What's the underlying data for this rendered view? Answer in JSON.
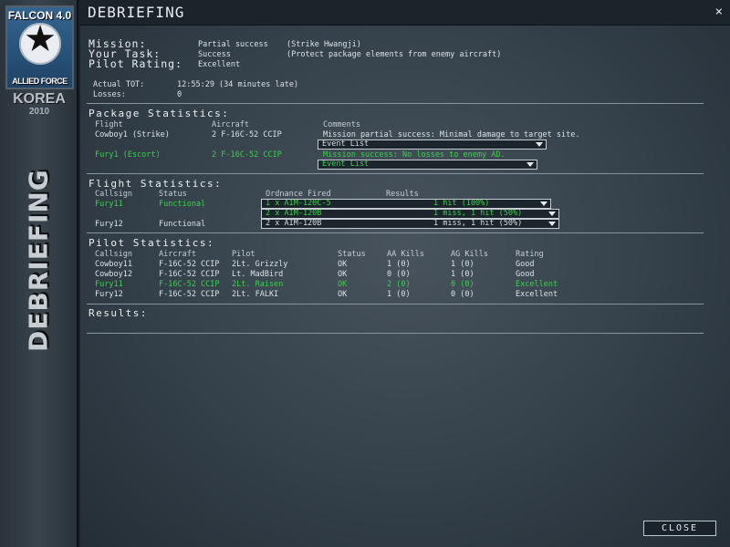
{
  "logo": {
    "top": "FALCON 4.0",
    "bottom": "ALLIED FORCE",
    "theater": "KOREA",
    "year": "2010"
  },
  "sidebar_title": "DEBRIEFING",
  "title": "DEBRIEFING",
  "close_x": "×",
  "summary": {
    "mission_label": "Mission:",
    "mission_value": "Partial success",
    "mission_note": "(Strike Hwangji)",
    "task_label": "Your Task:",
    "task_value": "Success",
    "task_note": "(Protect package elements from enemy aircraft)",
    "rating_label": "Pilot Rating:",
    "rating_value": "Excellent",
    "tot_label": "Actual TOT:",
    "tot_value": "12:55:29 (34 minutes late)",
    "losses_label": "Losses:",
    "losses_value": "0"
  },
  "package": {
    "title": "Package Statistics:",
    "headers": {
      "flight": "Flight",
      "aircraft": "Aircraft",
      "comments": "Comments"
    },
    "rows": [
      {
        "flight": "Cowboy1 (Strike)",
        "aircraft": "2 F-16C-52 CCIP",
        "comment": "Mission partial success: Minimal damage to target site.",
        "dropdown": "Event List",
        "highlight": false
      },
      {
        "flight": "Fury1 (Escort)",
        "aircraft": "2 F-16C-52 CCIP",
        "comment": "Mission success: No losses to enemy AD.",
        "dropdown": "Event List",
        "highlight": true
      }
    ]
  },
  "flight": {
    "title": "Flight Statistics:",
    "headers": {
      "callsign": "Callsign",
      "status": "Status",
      "ordnance": "Ordnance Fired",
      "results": "Results"
    },
    "rows": [
      {
        "callsign": "Fury11",
        "status": "Functional",
        "ordnance": [
          {
            "weapon": "1 x AIM-120C-5",
            "result": "1 hit (100%)"
          },
          {
            "weapon": "2 x AIM-120B",
            "result": "1 miss, 1 hit (50%)"
          }
        ]
      },
      {
        "callsign": "Fury12",
        "status": "Functional",
        "ordnance": [
          {
            "weapon": "2 x AIM-120B",
            "result": "1 miss, 1 hit (50%)"
          }
        ]
      }
    ]
  },
  "pilot": {
    "title": "Pilot Statistics:",
    "headers": {
      "callsign": "Callsign",
      "aircraft": "Aircraft",
      "pilot": "Pilot",
      "status": "Status",
      "aa": "AA Kills",
      "ag": "AG Kills",
      "rating": "Rating"
    },
    "rows": [
      {
        "callsign": "Cowboy11",
        "aircraft": "F-16C-52 CCIP",
        "pilot": "2Lt. Grizzly",
        "status": "OK",
        "aa": "1 (0)",
        "ag": "1 (0)",
        "rating": "Good",
        "highlight": false
      },
      {
        "callsign": "Cowboy12",
        "aircraft": "F-16C-52 CCIP",
        "pilot": "Lt. MadBird",
        "status": "OK",
        "aa": "0 (0)",
        "ag": "1 (0)",
        "rating": "Good",
        "highlight": false
      },
      {
        "callsign": "Fury11",
        "aircraft": "F-16C-52 CCIP",
        "pilot": "2Lt. Raisen",
        "status": "OK",
        "aa": "2 (0)",
        "ag": "0 (0)",
        "rating": "Excellent",
        "highlight": true
      },
      {
        "callsign": "Fury12",
        "aircraft": "F-16C-52 CCIP",
        "pilot": "2Lt. FALKI",
        "status": "OK",
        "aa": "1 (0)",
        "ag": "0 (0)",
        "rating": "Excellent",
        "highlight": false
      }
    ]
  },
  "results_title": "Results:",
  "close_button": "CLOSE",
  "colors": {
    "highlight": "#38d24a",
    "text": "#dde2e6"
  }
}
